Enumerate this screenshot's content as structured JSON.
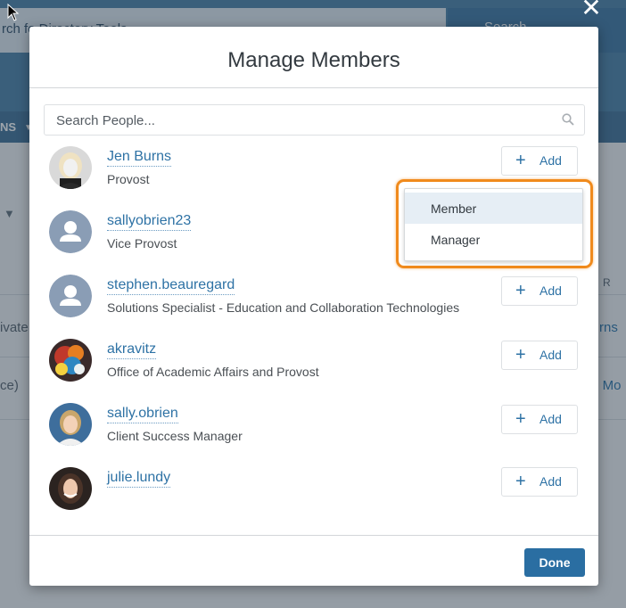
{
  "background": {
    "search_text": "rch fo   Directory Tools",
    "search_button": "Search",
    "nav_item": "NS",
    "left_cut_1": "ivate",
    "left_cut_2": "ce)",
    "right_cut_1": "rns",
    "right_cut_2": "s Mo",
    "right_cut_col": "R"
  },
  "modal": {
    "title": "Manage Members",
    "search_placeholder": "Search People...",
    "people": [
      {
        "name": "Jen Burns",
        "title": "Provost",
        "add_label": "Add",
        "avatar": "photo-woman-blonde"
      },
      {
        "name": "sallyobrien23",
        "title": "Vice Provost",
        "add_label": "Add",
        "avatar": "default-user-icon"
      },
      {
        "name": "stephen.beauregard",
        "title": "Solutions Specialist - Education and Collaboration Technologies",
        "add_label": "Add",
        "avatar": "default-user-icon"
      },
      {
        "name": "akravitz",
        "title": "Office of Academic Affairs and Provost",
        "add_label": "Add",
        "avatar": "photo-colorful-abstract"
      },
      {
        "name": "sally.obrien",
        "title": "Client Success Manager",
        "add_label": "Add",
        "avatar": "photo-woman-smiling"
      },
      {
        "name": "julie.lundy",
        "title": "",
        "add_label": "Add",
        "avatar": "photo-woman-brunette"
      }
    ],
    "done_label": "Done"
  },
  "dropdown": {
    "items": [
      "Member",
      "Manager"
    ],
    "active_index": 0
  },
  "colors": {
    "accent": "#2e72a5",
    "highlight": "#f08a1c",
    "primary_button": "#2a6ea2"
  }
}
